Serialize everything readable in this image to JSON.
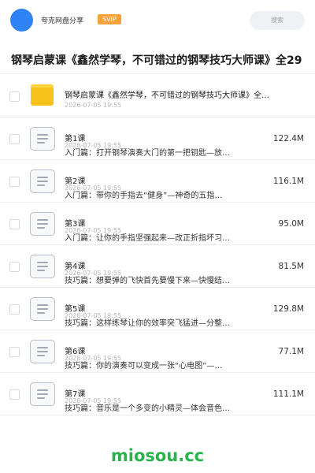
{
  "header": {
    "site_name": "夸克网盘分享",
    "svip_label": "SVIP",
    "search_label": "搜索"
  },
  "page_title": "钢琴启蒙课《鑫然学琴，不可错过的钢琴技巧大师课》全29",
  "folder": {
    "name": "钢琴启蒙课《鑫然学琴，不可错过的钢琴技巧大师课》全…",
    "date": "2026-07-05 19:55"
  },
  "files": [
    {
      "name": "第1课",
      "date": "2026-07-05 19:55",
      "desc": "入门篇：打开钢琴演奏大门的第一把钥匙—放…",
      "size": "122.4M"
    },
    {
      "name": "第2课",
      "date": "2026-07-05 19:55",
      "desc": "入门篇：带你的手指去“健身”—神奇的五指…",
      "size": "116.1M"
    },
    {
      "name": "第3课",
      "date": "2026-07-05 19:55",
      "desc": "入门篇：让你的手指坚强起来—改正折指坏习…",
      "size": "95.0M"
    },
    {
      "name": "第4课",
      "date": "2026-07-05 19:55",
      "desc": "技巧篇：想要弹的飞快首先要慢下来—快慢结…",
      "size": "81.5M"
    },
    {
      "name": "第5课",
      "date": "2026-07-05 19:55",
      "desc": "技巧篇：这样练琴让你的效率突飞猛进—分整…",
      "size": "129.8M"
    },
    {
      "name": "第6课",
      "date": "2026-07-05 19:55",
      "desc": "技巧篇：你的演奏可以变成一张“心电图”—…",
      "size": "77.1M"
    },
    {
      "name": "第7课",
      "date": "2026-07-05 19:55",
      "desc": "技巧篇：音乐是一个多变的小精灵—体会音色…",
      "size": "111.1M"
    }
  ],
  "watermark": "miosou.cc"
}
